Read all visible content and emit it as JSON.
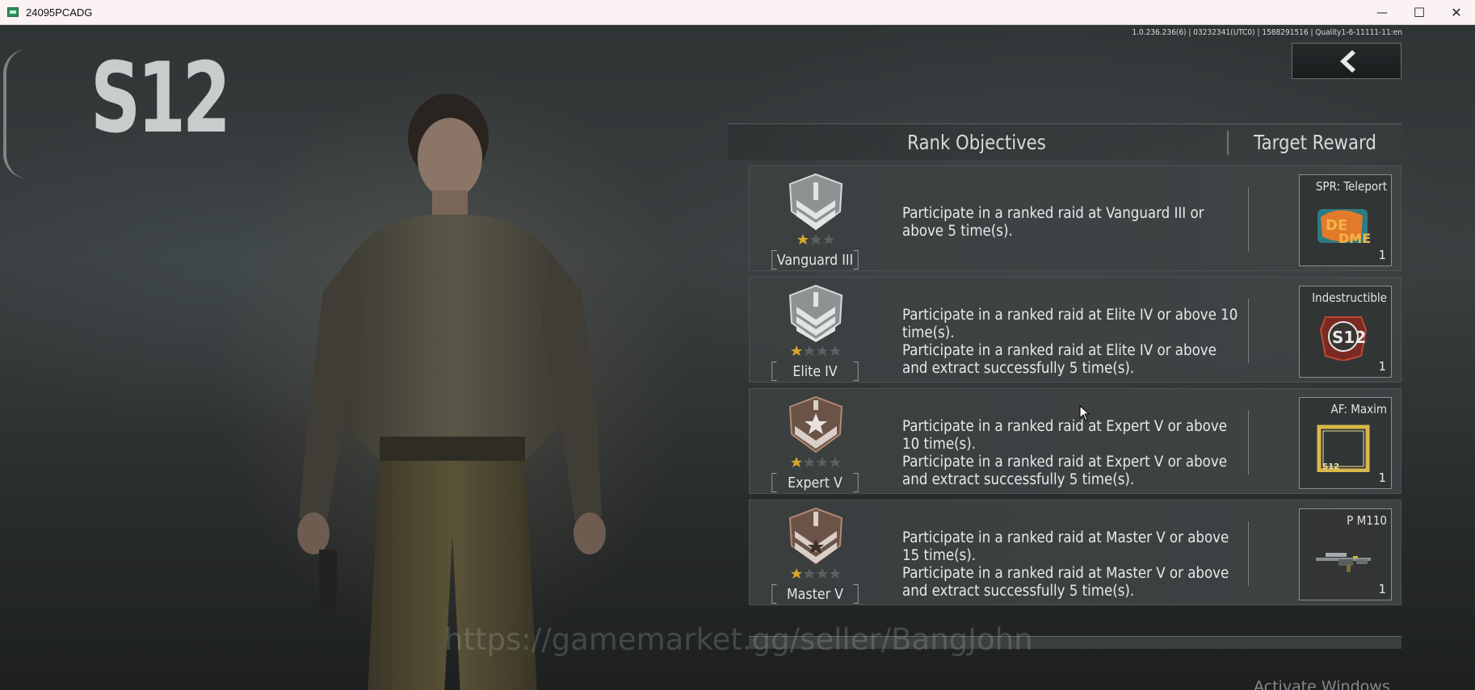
{
  "window": {
    "title": "24095PCADG",
    "controls": {
      "minimize": "—",
      "maximize": "☐",
      "close": "✕"
    }
  },
  "hud": {
    "season": "S12",
    "version_info": "1.0.236.236(6) | 03232341(UTC0) | 1588291516 | Quality1-6-11111-11:en",
    "back_icon": "chevron-left-icon"
  },
  "panel": {
    "header_objectives": "Rank Objectives",
    "header_reward": "Target Reward",
    "rows": [
      {
        "rank": "Vanguard III",
        "tier": "silver",
        "stars": 1,
        "objectives": [
          "Participate in a ranked raid at Vanguard III or above 5 time(s)."
        ],
        "reward_name": "SPR: Teleport",
        "reward_count": "1"
      },
      {
        "rank": "Elite IV",
        "tier": "silver",
        "stars": 1,
        "objectives": [
          "Participate in a ranked raid at Elite IV or above 10 time(s).",
          "Participate in a ranked raid at Elite IV or above and extract successfully 5 time(s)."
        ],
        "reward_name": "Indestructible",
        "reward_count": "1"
      },
      {
        "rank": "Expert V",
        "tier": "bronze",
        "stars": 1,
        "objectives": [
          "Participate in a ranked raid at Expert V or above 10 time(s).",
          "Participate in a ranked raid at Expert V or above and extract successfully 5 time(s)."
        ],
        "reward_name": "AF: Maxim",
        "reward_count": "1"
      },
      {
        "rank": "Master V",
        "tier": "bronze",
        "stars": 1,
        "objectives": [
          "Participate in a ranked raid at Master V or above 15 time(s).",
          "Participate in a ranked raid at Master V or above and extract successfully 5 time(s)."
        ],
        "reward_name": "P M110",
        "reward_count": "1"
      }
    ]
  },
  "overlay": {
    "watermark": "https://gamemarket.gg/seller/BangJohn",
    "activate_windows": "Activate Windows"
  },
  "colors": {
    "silver": "#c8cbcc",
    "bronze": "#9b7a66",
    "gold_star": "#d9a62b"
  }
}
